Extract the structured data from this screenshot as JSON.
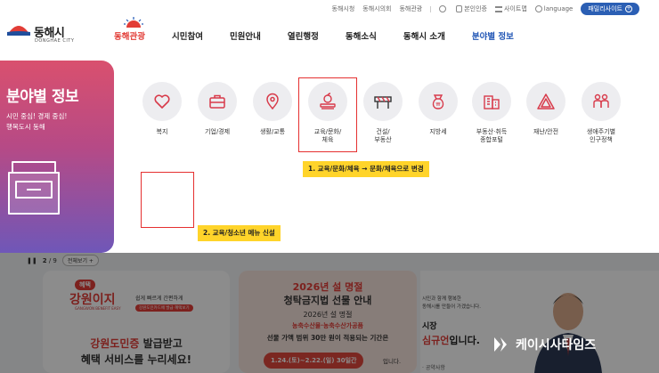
{
  "utility": {
    "links": [
      "동해시청",
      "동해시의회",
      "동해관광",
      "본인인증",
      "사이트맵",
      "language"
    ],
    "family_site": "패밀리사이트"
  },
  "logo": {
    "name": "동해시",
    "sub": "DONGHAE CITY"
  },
  "gnb": [
    "동해관광",
    "시민참여",
    "민원안내",
    "열린행정",
    "동해소식",
    "동해시 소개",
    "분야별 정보"
  ],
  "sidebar": {
    "title": "분야별 정보",
    "desc_line1": "시민 중심! 경제 중심!",
    "desc_line2": "행복도시 동해"
  },
  "categories": [
    {
      "label": "복지",
      "icon": "heart-icon"
    },
    {
      "label": "기업/경제",
      "icon": "briefcase-icon"
    },
    {
      "label": "생활/교통",
      "icon": "map-pin-icon"
    },
    {
      "label": "교육/문화/\n체육",
      "icon": "apple-book-icon"
    },
    {
      "label": "건설/\n부동산",
      "icon": "barrier-icon"
    },
    {
      "label": "지방세",
      "icon": "money-bag-icon"
    },
    {
      "label": "부동산·취득\n종합포털",
      "icon": "building-icon"
    },
    {
      "label": "재난/안전",
      "icon": "warning-icon"
    },
    {
      "label": "생애주기별\n인구정책",
      "icon": "family-icon"
    }
  ],
  "annotations": {
    "note1": "1. 교육/문화/체육 → 문화/체육으로 변경",
    "note2": "2. 교육/청소년 메뉴 신설"
  },
  "background": {
    "pager": "2",
    "pager_total": "/ 9",
    "view_all": "전체보기 +",
    "card1": {
      "badge": "혜택",
      "brand": "강원이지",
      "brand_sub": "GANGWON BENEFIT EASY",
      "tag1": "쉽게 빠르게 간편하게",
      "tag2": "강원도민카드에 발급 혜택보기",
      "line1_red": "강원도민증",
      "line1_rest": " 발급받고",
      "line2": "혜택 서비스를 누리세요!"
    },
    "card2": {
      "line1_red": "2026년 설 명절",
      "line2": "청탁금지법 선물 안내",
      "line3": "2026년 설 명절",
      "line4": "농축수산물·농축수산가공품",
      "line5": "선물 가액 범위 30만 원이 적용되는 기간은",
      "date": "1.24.(토)~2.22.(일) 30일간",
      "date_suffix": "입니다."
    },
    "card3": {
      "desc1": "시민과 함께 행복한",
      "desc2": "동해시를 만들어 가겠습니다.",
      "title": "시장",
      "name_red": "심규언",
      "name_rest": "입니다.",
      "more": "· 공약사항"
    }
  },
  "watermark": "케이시사타임즈",
  "colors": {
    "accent_blue": "#2357b6",
    "tour_red": "#e23d37",
    "annotation_red": "#e53030",
    "annotation_yellow": "#ffd42a",
    "sidebar_gradient_top": "#d9506e",
    "sidebar_gradient_bottom": "#6f57b8"
  }
}
